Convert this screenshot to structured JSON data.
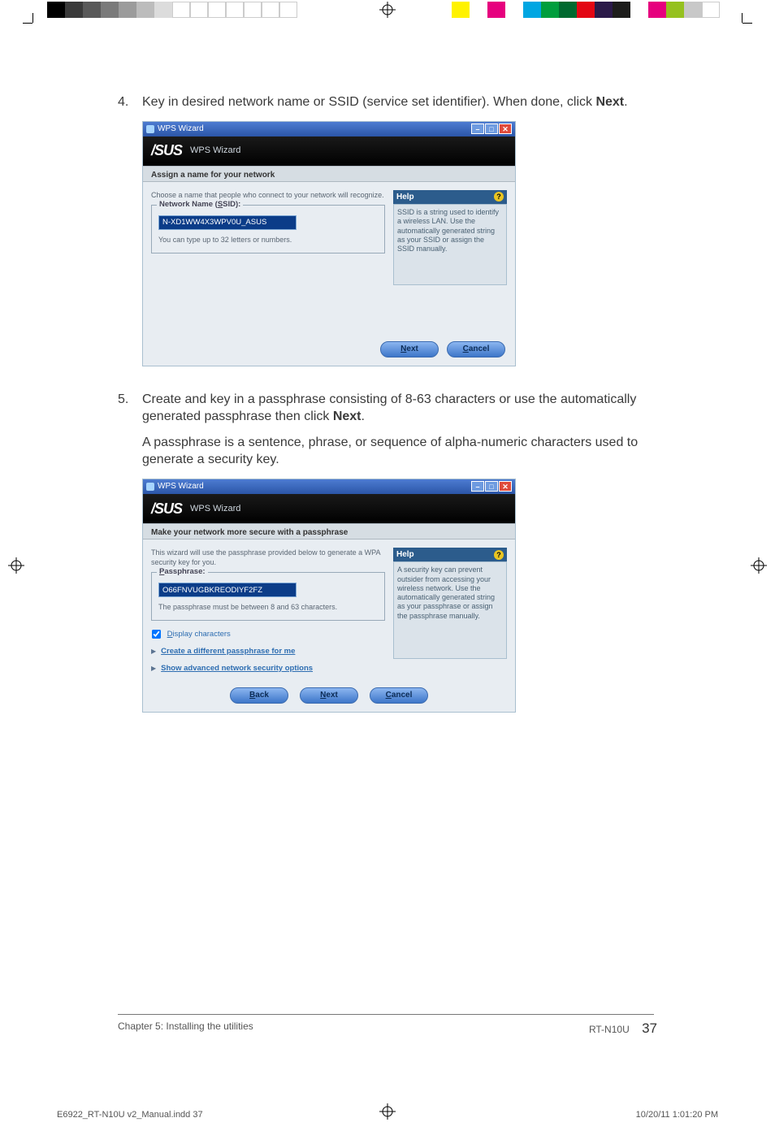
{
  "color_bar": {
    "left": [
      "#000000",
      "#3a3a3a",
      "#595959",
      "#7a7a7a",
      "#9b9b9b",
      "#bcbcbc",
      "#dcdcdc",
      "#ffffff"
    ],
    "right": [
      "#f4e600",
      "#e6007e",
      "#00a6e2",
      "#009e3d",
      "#00923f",
      "#e30613",
      "#1d1d1b",
      "#ffffff",
      "#e6007e",
      "#95c11f",
      "#c8c8c8",
      "#ffffff"
    ]
  },
  "steps": {
    "s4": {
      "num": "4.",
      "text_before": "Key in desired network name or SSID (service set identifier). When done, click ",
      "bold": "Next",
      "text_after": "."
    },
    "s5": {
      "num": "5.",
      "line1_before": "Create and key in a passphrase consisting of 8-63 characters or use the automatically generated passphrase then click ",
      "line1_bold": "Next",
      "line1_after": ".",
      "note": "A passphrase is a sentence, phrase, or sequence of alpha-numeric characters used to generate a security key."
    }
  },
  "shot1": {
    "title": "WPS Wizard",
    "brand": "/SUS",
    "brand_sub": "WPS Wizard",
    "strip": "Assign a name for your network",
    "intro": "Choose a name that people who connect to your network will recognize.",
    "legend_u": "S",
    "legend_rest": "SID):",
    "legend_pre": "Network Name (",
    "value": "N-XD1WW4X3WPV0U_ASUS",
    "hint": "You can type up to 32 letters or numbers.",
    "help_title": "Help",
    "help_body": "SSID is a string used to identify a wireless LAN. Use the automatically generated string as your SSID or assign the SSID manually.",
    "btn_next_u": "N",
    "btn_next": "ext",
    "btn_cancel_u": "C",
    "btn_cancel": "ancel"
  },
  "shot2": {
    "title": "WPS Wizard",
    "brand": "/SUS",
    "brand_sub": "WPS Wizard",
    "strip": "Make your network more secure with a passphrase",
    "intro": "This wizard will use the passphrase provided below to generate a WPA security key for you.",
    "legend_u": "P",
    "legend_rest": "assphrase:",
    "value": "O66FNVUGBKREODIYF2FZ",
    "hint": "The passphrase must be between 8 and 63 characters.",
    "check_u": "D",
    "check_rest": "isplay characters",
    "link1": "Create a different passphrase for me",
    "link2": "Show advanced network security options",
    "help_title": "Help",
    "help_body": "A security key can prevent outsider from accessing your wireless network. Use the automatically generated string as your passphrase or assign the passphrase manually.",
    "btn_back_u": "B",
    "btn_back": "ack",
    "btn_next_u": "N",
    "btn_next": "ext",
    "btn_cancel_u": "C",
    "btn_cancel": "ancel"
  },
  "footer": {
    "left": "Chapter 5: Installing the utilities",
    "right_model": "RT-N10U",
    "page": "37"
  },
  "slug": {
    "file": "E6922_RT-N10U v2_Manual.indd   37",
    "stamp": "10/20/11   1:01:20 PM"
  }
}
